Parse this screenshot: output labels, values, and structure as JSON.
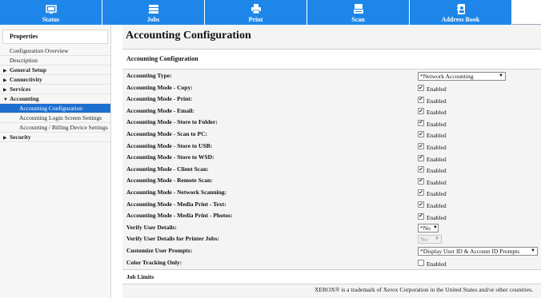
{
  "nav": {
    "tabs": [
      {
        "label": "Status",
        "icon": "status-icon"
      },
      {
        "label": "Jobs",
        "icon": "jobs-icon"
      },
      {
        "label": "Print",
        "icon": "printer-icon"
      },
      {
        "label": "Scan",
        "icon": "scanner-icon"
      },
      {
        "label": "Address Book",
        "icon": "address-book-icon"
      }
    ],
    "accent": "#1e86e8"
  },
  "sidebar": {
    "title": "Properties",
    "items": [
      {
        "label": "Configuration Overview"
      },
      {
        "label": "Description"
      },
      {
        "label": "General Setup"
      },
      {
        "label": "Connectivity"
      },
      {
        "label": "Services"
      },
      {
        "label": "Accounting"
      },
      {
        "label": "Accounting Configuration"
      },
      {
        "label": "Accounting Login Screen Settings"
      },
      {
        "label": "Accounting / Billing Device Settings"
      },
      {
        "label": "Security"
      }
    ]
  },
  "main": {
    "title": "Accounting Configuration",
    "section_title": "Accounting Configuration",
    "rows": [
      {
        "label": "Accounting Type:",
        "value": "*Network Accounting"
      },
      {
        "label": "Accounting Mode - Copy:",
        "value": "Enabled"
      },
      {
        "label": "Accounting Mode - Print:",
        "value": "Enabled"
      },
      {
        "label": "Accounting Mode - Email:",
        "value": "Enabled"
      },
      {
        "label": "Accounting Mode - Store to Folder:",
        "value": "Enabled"
      },
      {
        "label": "Accounting Mode - Scan to PC:",
        "value": "Enabled"
      },
      {
        "label": "Accounting Mode - Store to USB:",
        "value": "Enabled"
      },
      {
        "label": "Accounting Mode - Store to WSD:",
        "value": "Enabled"
      },
      {
        "label": "Accounting Mode - Client Scan:",
        "value": "Enabled"
      },
      {
        "label": "Accounting Mode - Remote Scan:",
        "value": "Enabled"
      },
      {
        "label": "Accounting Mode - Network Scanning:",
        "value": "Enabled"
      },
      {
        "label": "Accounting Mode - Media Print - Text:",
        "value": "Enabled"
      },
      {
        "label": "Accounting Mode - Media Print - Photos:",
        "value": "Enabled"
      },
      {
        "label": "Verify User Details:",
        "value": "*No"
      },
      {
        "label": "Verify User Details for Printer Jobs:",
        "value": "No"
      },
      {
        "label": "Customize User Prompts:",
        "value": "*Display User ID & Account ID Prompts"
      },
      {
        "label": "Color Tracking Only:",
        "value": "Enabled"
      }
    ],
    "job_limits": "Job Limits",
    "footer": "XEROX® is a trademark of Xerox Corporation in the United States and/or other countries."
  }
}
